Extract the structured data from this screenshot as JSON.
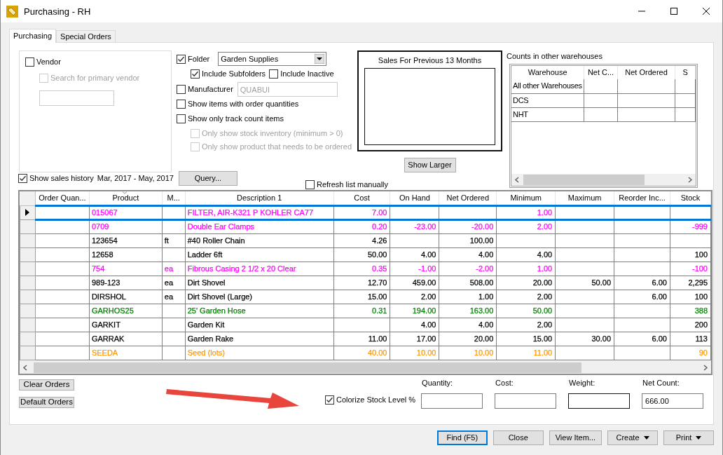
{
  "window": {
    "title": "Purchasing - RH"
  },
  "tabs": [
    {
      "label": "Purchasing",
      "selected": true
    },
    {
      "label": "Special Orders",
      "selected": false
    }
  ],
  "vendor": {
    "label": "Vendor",
    "checked": false,
    "search_primary": {
      "label": "Search for primary vendor",
      "checked": false,
      "disabled": true
    }
  },
  "folder": {
    "label": "Folder",
    "checked": true,
    "value": "Garden Supplies"
  },
  "folder_options": [
    {
      "label": "Include Subfolders",
      "checked": true
    },
    {
      "label": "Include Inactive",
      "checked": false
    }
  ],
  "manufacturer": {
    "label": "Manufacturer",
    "checked": false,
    "value": "QUABUI",
    "disabled": true
  },
  "options": [
    {
      "label": "Show items with order quantities",
      "checked": false,
      "disabled": false,
      "indented": false
    },
    {
      "label": "Show only track count items",
      "checked": false,
      "disabled": false,
      "indented": false
    },
    {
      "label": "Only show stock inventory (minimum > 0)",
      "checked": false,
      "disabled": true,
      "indented": true
    },
    {
      "label": "Only show product that needs to be ordered",
      "checked": false,
      "disabled": true,
      "indented": true
    }
  ],
  "sales_chart": {
    "title": "Sales For Previous 13 Months",
    "button": "Show Larger"
  },
  "warehouses": {
    "title": "Counts in other warehouses",
    "columns": [
      "Warehouse",
      "Net C...",
      "Net Ordered",
      "S"
    ],
    "rows": [
      {
        "name": "All other Warehouses"
      },
      {
        "name": "DCS"
      },
      {
        "name": "NHT"
      }
    ]
  },
  "sales_history": {
    "label": "Show sales history",
    "checked": true,
    "range": "Mar, 2017 - May, 2017",
    "button": "Query..."
  },
  "refresh_manually": {
    "label": "Refresh list manually",
    "checked": false
  },
  "grid": {
    "columns": [
      "Order Quan...",
      "Product",
      "M...",
      "Description 1",
      "Cost",
      "On Hand",
      "Net Ordered",
      "Minimum",
      "Maximum",
      "Reorder Inc...",
      "Stock"
    ],
    "rows": [
      {
        "product": "015067",
        "description": "FILTER, AIR-K321 P KOHLER CA77",
        "cost": "7.00",
        "minimum": "1.00",
        "color": "#ff00ff",
        "selected": true
      },
      {
        "product": "0709",
        "description": "Double Ear Clamps",
        "cost": "0.20",
        "on_hand": "-23.00",
        "net_ordered": "-20.00",
        "minimum": "2.00",
        "stock": "-999",
        "color": "#ff00ff",
        "selected": false
      },
      {
        "product": "123654",
        "m": "ft",
        "description": "#40 Roller Chain",
        "cost": "4.26",
        "net_ordered": "100.00",
        "color": "#000000",
        "selected": false
      },
      {
        "product": "12658",
        "description": "Ladder 6ft",
        "cost": "50.00",
        "on_hand": "4.00",
        "net_ordered": "4.00",
        "minimum": "4.00",
        "stock": "100",
        "color": "#000000",
        "selected": false
      },
      {
        "product": "754",
        "m": "ea",
        "description": "Fibrous Casing 2 1/2 x 20 Clear",
        "cost": "0.35",
        "on_hand": "-1.00",
        "net_ordered": "-2.00",
        "minimum": "1.00",
        "stock": "-100",
        "color": "#ff00ff",
        "selected": false
      },
      {
        "product": "989-123",
        "m": "ea",
        "description": "Dirt Shovel",
        "cost": "12.70",
        "on_hand": "459.00",
        "net_ordered": "508.00",
        "minimum": "20.00",
        "maximum": "50.00",
        "reorder_inc": "6.00",
        "stock": "2,295",
        "color": "#000000",
        "selected": false
      },
      {
        "product": "DIRSHOL",
        "m": "ea",
        "description": "Dirt Shovel (Large)",
        "cost": "15.00",
        "on_hand": "2.00",
        "net_ordered": "1.00",
        "minimum": "2.00",
        "reorder_inc": "6.00",
        "stock": "100",
        "color": "#000000",
        "selected": false
      },
      {
        "product": "GARHOS25",
        "description": "25' Garden Hose",
        "cost": "0.31",
        "on_hand": "194.00",
        "net_ordered": "163.00",
        "minimum": "50.00",
        "stock": "388",
        "color": "#008000",
        "selected": false
      },
      {
        "product": "GARKIT",
        "description": "Garden Kit",
        "on_hand": "4.00",
        "net_ordered": "4.00",
        "minimum": "2.00",
        "stock": "200",
        "color": "#000000",
        "selected": false
      },
      {
        "product": "GARRAK",
        "description": "Garden Rake",
        "cost": "11.00",
        "on_hand": "17.00",
        "net_ordered": "20.00",
        "minimum": "15.00",
        "maximum": "30.00",
        "reorder_inc": "6.00",
        "stock": "113",
        "color": "#000000",
        "selected": false
      },
      {
        "product": "SEEDA",
        "description": "Seed (lots)",
        "cost": "40.00",
        "on_hand": "10.00",
        "net_ordered": "10.00",
        "minimum": "11.00",
        "stock": "90",
        "color": "#ff9900",
        "selected": false
      }
    ]
  },
  "order_buttons": [
    "Clear Orders",
    "Default Orders"
  ],
  "colorize": {
    "label": "Colorize Stock Level %",
    "checked": true
  },
  "totals": [
    {
      "label": "Quantity:",
      "focused": false
    },
    {
      "label": "Cost:",
      "focused": false
    },
    {
      "label": "Weight:",
      "focused": true
    },
    {
      "label": "Net Count:",
      "value": "666.00",
      "focused": false
    }
  ],
  "buttons": [
    {
      "label": "Find (F5)",
      "default": true,
      "menu": false
    },
    {
      "label": "Close",
      "default": false,
      "menu": false
    },
    {
      "label": "View Item...",
      "default": false,
      "menu": false
    },
    {
      "label": "Create",
      "default": false,
      "menu": true
    },
    {
      "label": "Print",
      "default": false,
      "menu": true
    }
  ]
}
